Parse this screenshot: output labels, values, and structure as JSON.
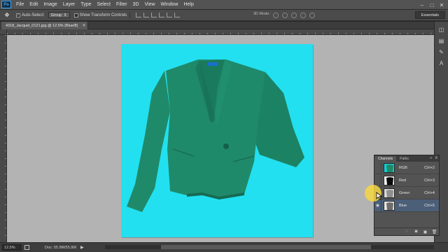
{
  "app": {
    "logo": "Ps",
    "menu": [
      "File",
      "Edit",
      "Image",
      "Layer",
      "Type",
      "Select",
      "Filter",
      "3D",
      "View",
      "Window",
      "Help"
    ],
    "window_controls": [
      "–",
      "□",
      "✕"
    ]
  },
  "options_bar": {
    "tool_icon": "move-tool-icon",
    "auto_select_label": "Auto-Select:",
    "auto_select_checked": true,
    "group_value": "Group",
    "show_transform_label": "Show Transform Controls",
    "show_transform_checked": false,
    "mode_3d_label": "3D Mode:",
    "workspace": "Essentials"
  },
  "document": {
    "tab_title": "4318_Jacquel_0121.jpg @ 12.5% (Blue/8)",
    "background_color": "#22e0ef",
    "jacket_color": "#1f8a6a"
  },
  "status_bar": {
    "zoom": "12.5%",
    "doc_size": "Doc: 55.9M/55.9M"
  },
  "channels_panel": {
    "tabs": [
      "Channels",
      "Paths"
    ],
    "active_tab": "Channels",
    "channels": [
      {
        "name": "RGB",
        "shortcut": "Ctrl+2",
        "visible": false,
        "selected": false
      },
      {
        "name": "Red",
        "shortcut": "Ctrl+3",
        "visible": false,
        "selected": false
      },
      {
        "name": "Green",
        "shortcut": "Ctrl+4",
        "visible": false,
        "selected": false
      },
      {
        "name": "Blue",
        "shortcut": "Ctrl+5",
        "visible": true,
        "selected": true
      }
    ],
    "footer_icons": [
      "load-selection-icon",
      "save-selection-icon",
      "new-channel-icon",
      "delete-channel-icon"
    ]
  },
  "colors": {
    "cursor_highlight": "#f6d642",
    "selected_row": "#4c5f78"
  }
}
